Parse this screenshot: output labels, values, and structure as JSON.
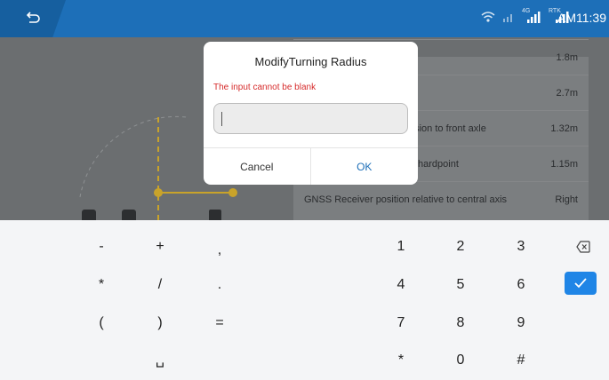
{
  "status_bar": {
    "time": "AM11:39",
    "icons": [
      "back-icon",
      "wifi-icon",
      "signal-icon",
      "lte-signal-icon",
      "rtk-signal-icon"
    ],
    "network_label": "4G",
    "rtk_label": "RTK"
  },
  "background_list": {
    "rows": [
      {
        "label": "",
        "value": "1.8m"
      },
      {
        "label": "",
        "value": "2.7m"
      },
      {
        "label": "nsion to front axle",
        "value": "1.32m"
      },
      {
        "label": "hardpoint",
        "value": "1.15m"
      },
      {
        "label": "GNSS Receiver position relative to central axis",
        "value": "Right"
      }
    ]
  },
  "dialog": {
    "title": "ModifyTurning Radius",
    "error": "The input cannot be blank",
    "input_value": "",
    "cancel_label": "Cancel",
    "ok_label": "OK"
  },
  "keyboard": {
    "symbols": [
      "-",
      "+",
      ",",
      "*",
      "/",
      ".",
      "(",
      ")",
      "=",
      "␣"
    ],
    "digits": [
      "1",
      "2",
      "3",
      "4",
      "5",
      "6",
      "7",
      "8",
      "9",
      "*",
      "0",
      "#"
    ],
    "enter_icon": "check-icon",
    "backspace_icon": "backspace-icon",
    "colors": {
      "accent": "#1f85e6",
      "statusbar": "#1d6fb8",
      "error": "#d62b2b"
    }
  }
}
